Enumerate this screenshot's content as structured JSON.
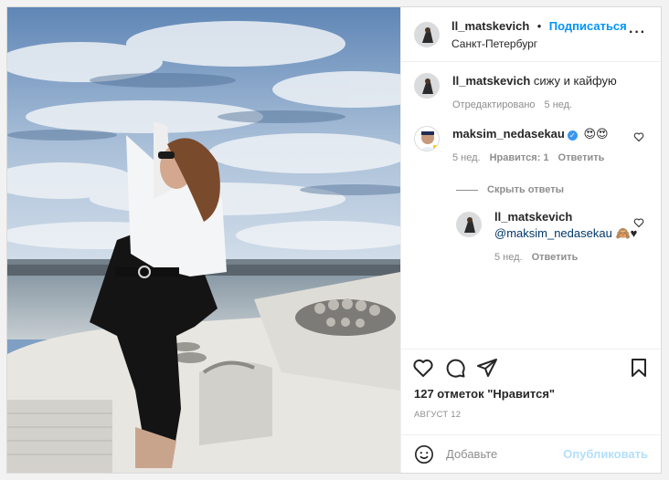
{
  "post": {
    "author": "ll_matskevich",
    "follow_label": "Подписаться",
    "dot": "•",
    "location": "Санкт-Петербург",
    "more_icon": "more-horizontal-icon"
  },
  "caption": {
    "author": "ll_matskevich",
    "text": "сижу и кайфую",
    "edited": "Отредактировано",
    "time": "5 нед."
  },
  "comments": [
    {
      "author": "maksim_nedasekau",
      "verified": true,
      "text": "😍😍",
      "time": "5 нед.",
      "likes": "Нравится: 1",
      "reply_label": "Ответить"
    }
  ],
  "hide_replies_label": "Скрыть ответы",
  "reply": {
    "author": "ll_matskevich",
    "mention": "@maksim_nedasekau",
    "text": "🙈♥",
    "time": "5 нед.",
    "reply_label": "Ответить"
  },
  "likes_text": "127 отметок \"Нравится\"",
  "date_text": "АВГУСТ 12",
  "comment_box": {
    "placeholder": "Добавьте",
    "publish_label": "Опубликовать"
  },
  "colors": {
    "accent": "#0095f6",
    "publish_disabled": "#b2dffc",
    "secondary_text": "#8e8e8e",
    "verified": "#3897f0"
  }
}
